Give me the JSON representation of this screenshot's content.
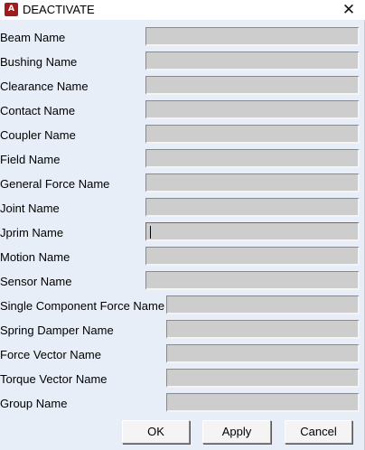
{
  "window": {
    "title": "DEACTIVATE",
    "icon_letter": "A",
    "close_glyph": "✕"
  },
  "fields": [
    {
      "label": "Beam Name",
      "value": ""
    },
    {
      "label": "Bushing Name",
      "value": ""
    },
    {
      "label": "Clearance Name",
      "value": ""
    },
    {
      "label": "Contact Name",
      "value": ""
    },
    {
      "label": "Coupler Name",
      "value": ""
    },
    {
      "label": "Field Name",
      "value": ""
    },
    {
      "label": "General Force Name",
      "value": ""
    },
    {
      "label": "Joint Name",
      "value": ""
    },
    {
      "label": "Jprim Name",
      "value": ""
    },
    {
      "label": "Motion Name",
      "value": ""
    },
    {
      "label": "Sensor Name",
      "value": ""
    },
    {
      "label": "Single Component Force Name",
      "value": ""
    },
    {
      "label": "Spring Damper Name",
      "value": ""
    },
    {
      "label": "Force Vector Name",
      "value": ""
    },
    {
      "label": "Torque Vector Name",
      "value": ""
    },
    {
      "label": "Group Name",
      "value": ""
    }
  ],
  "buttons": {
    "ok": "OK",
    "apply": "Apply",
    "cancel": "Cancel"
  },
  "colors": {
    "dialog_bg": "#e8eef8",
    "field_bg": "#cdcdcd",
    "icon_bg": "#a01c1c"
  }
}
